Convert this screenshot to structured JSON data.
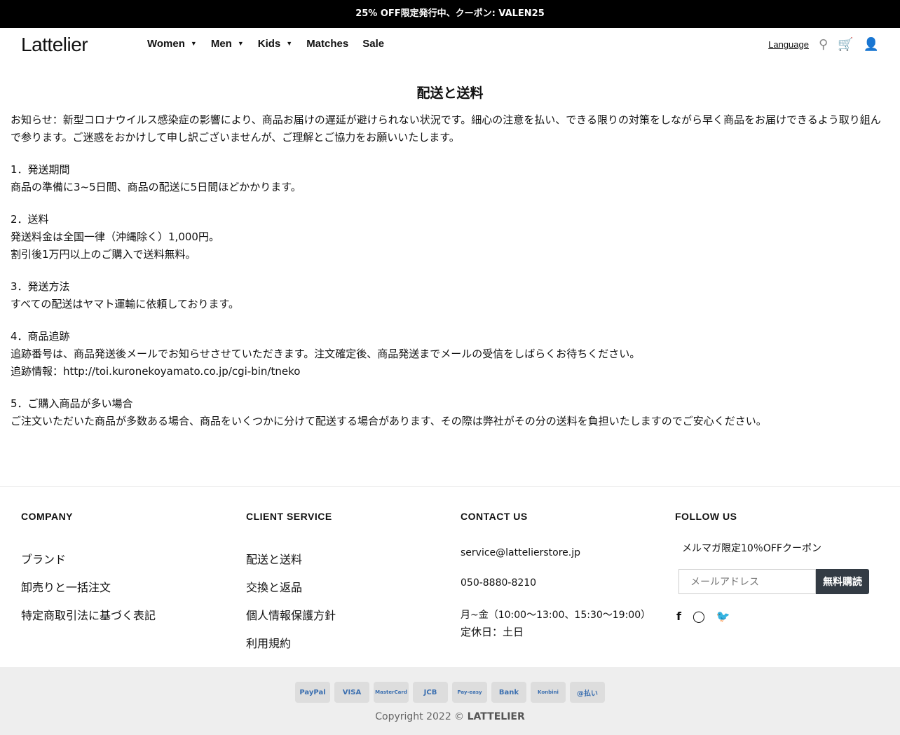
{
  "topbar": {
    "text": "25% OFF限定発行中、クーポン: VALEN25"
  },
  "header": {
    "logo": "Lattelier",
    "nav": [
      {
        "label": "Women",
        "caret": true
      },
      {
        "label": "Men",
        "caret": true
      },
      {
        "label": "Kids",
        "caret": true
      },
      {
        "label": "Matches"
      },
      {
        "label": "Sale"
      }
    ],
    "language": "Language"
  },
  "page": {
    "title": "配送と送料",
    "notice": "お知らせ：新型コロナウイルス感染症の影響により、商品お届けの遅延が避けられない状況です。細心の注意を払い、できる限りの対策をしながら早く商品をお届けできるよう取り組んで参ります。ご迷惑をおかけして申し訳ございませんが、ご理解とご協力をお願いいたします。",
    "sections": [
      {
        "heading": "1．発送期間",
        "lines": [
          "商品の準備に3~5日間、商品の配送に5日間ほどかかります。"
        ]
      },
      {
        "heading": "2．送料",
        "lines": [
          "発送料金は全国一律（沖縄除く）1,000円。",
          "割引後1万円以上のご購入で送料無料。"
        ]
      },
      {
        "heading": "3．発送方法",
        "lines": [
          "すべての配送はヤマト運輸に依頼しております。"
        ]
      },
      {
        "heading": "4．商品追跡",
        "lines": [
          "追跡番号は、商品発送後メールでお知らせさせていただきます。注文確定後、商品発送までメールの受信をしばらくお待ちください。",
          "追跡情報：http://toi.kuronekoyamato.co.jp/cgi-bin/tneko"
        ]
      },
      {
        "heading": "5．ご購入商品が多い場合",
        "lines": [
          "ご注文いただいた商品が多数ある場合、商品をいくつかに分けて配送する場合があります、その際は弊社がその分の送料を負担いたしますのでご安心ください。"
        ]
      }
    ]
  },
  "footer": {
    "company": {
      "title": "COMPANY",
      "links": [
        "ブランド",
        "卸売りと一括注文",
        "特定商取引法に基づく表記"
      ]
    },
    "client": {
      "title": "CLIENT SERVICE",
      "links": [
        "配送と送料",
        "交換と返品",
        "個人情報保護方針",
        "利用規約"
      ]
    },
    "contact": {
      "title": "CONTACT US",
      "email": "service@lattelierstore.jp",
      "phone": "050-8880-8210",
      "hours": "月~金（10:00～13:00、15:30～19:00）",
      "holiday": "定休日：土日"
    },
    "follow": {
      "title": "FOLLOW US",
      "promo": "メルマガ限定10％OFFクーポン",
      "placeholder": "メールアドレス",
      "button": "無料購読"
    },
    "payments": [
      "PayPal",
      "VISA",
      "MasterCard",
      "JCB",
      "Pay-easy",
      "Bank",
      "Konbini",
      "@払い"
    ],
    "copyright": "Copyright 2022 ©",
    "brand": "LATTELIER"
  }
}
